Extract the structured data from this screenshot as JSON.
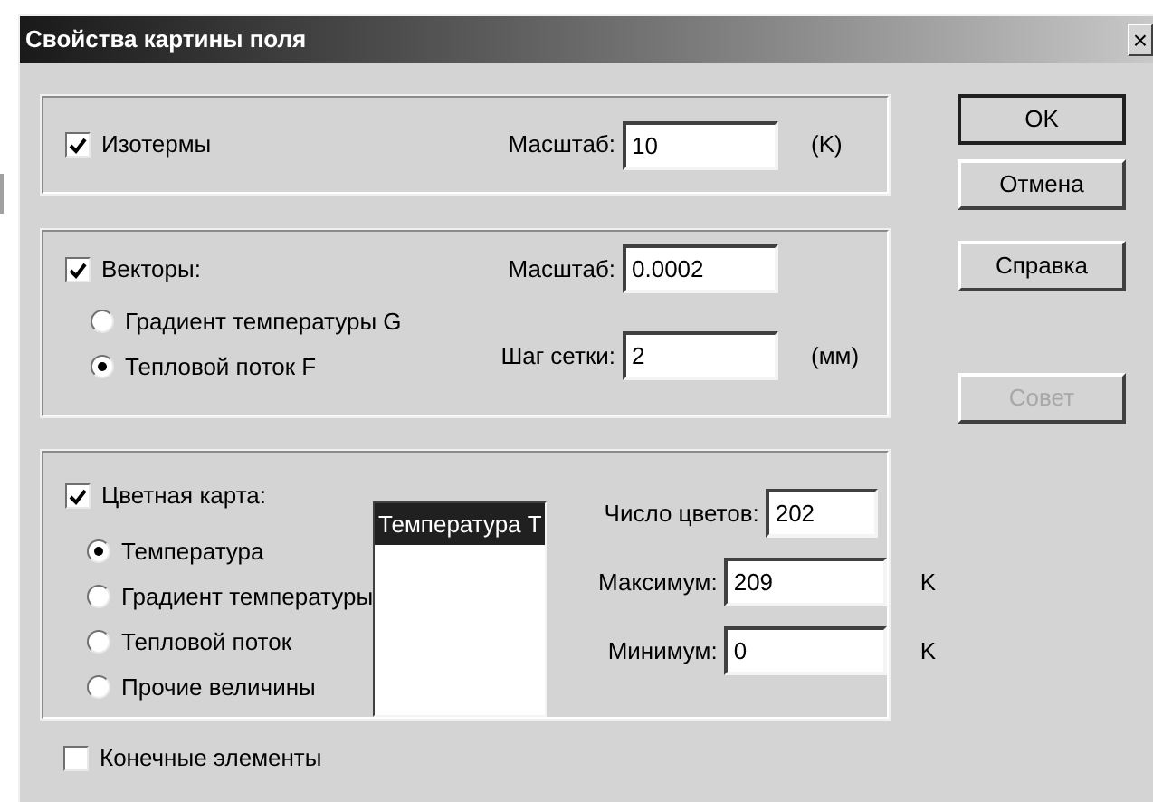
{
  "window": {
    "title": "Свойства картины поля",
    "close": "×"
  },
  "isotherms": {
    "label": "Изотермы",
    "checked": true,
    "scale_label": "Масштаб:",
    "scale": "10",
    "unit": "(K)"
  },
  "vectors": {
    "label": "Векторы:",
    "checked": true,
    "options": [
      {
        "label": "Градиент температуры G",
        "selected": false
      },
      {
        "label": "Тепловой поток F",
        "selected": true
      }
    ],
    "scale_label": "Масштаб:",
    "scale": "0.0002",
    "grid_label": "Шаг сетки:",
    "grid": "2",
    "grid_unit": "(мм)"
  },
  "color_map": {
    "label": "Цветная карта:",
    "checked": true,
    "options": [
      {
        "label": "Температура",
        "selected": true
      },
      {
        "label": "Градиент температуры",
        "selected": false
      },
      {
        "label": "Тепловой поток",
        "selected": false
      },
      {
        "label": "Прочие величины",
        "selected": false
      }
    ],
    "list": [
      {
        "label": "Температура T",
        "selected": true
      }
    ],
    "fields": [
      {
        "label": "Число цветов:",
        "value": "202"
      },
      {
        "label": "Максимум:",
        "value": "209",
        "unit": "K"
      },
      {
        "label": "Минимум:",
        "value": "0",
        "unit": "K"
      }
    ]
  },
  "finite_elements": {
    "label": "Конечные элементы",
    "checked": false
  },
  "buttons": [
    {
      "label": "OK",
      "default": true,
      "disabled": false
    },
    {
      "label": "Отмена",
      "default": false,
      "disabled": false
    },
    {
      "label": "Справка",
      "default": false,
      "disabled": false
    },
    {
      "label": "Совет",
      "default": false,
      "disabled": true
    }
  ]
}
